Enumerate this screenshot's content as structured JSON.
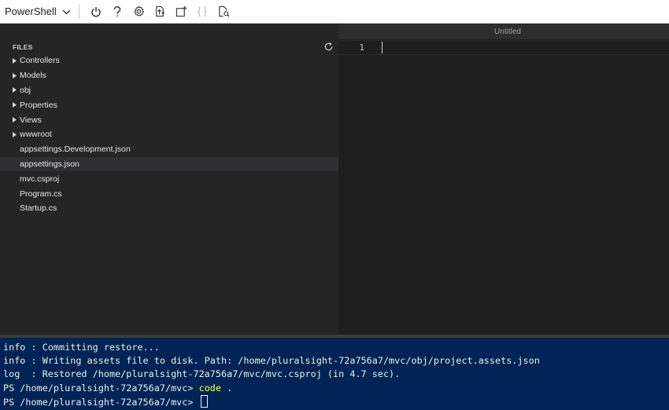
{
  "toolbar": {
    "shell_label": "PowerShell",
    "buttons": [
      {
        "name": "power-icon"
      },
      {
        "name": "help-icon"
      },
      {
        "name": "settings-icon"
      },
      {
        "name": "upload-download-icon"
      },
      {
        "name": "open-new-session-icon"
      },
      {
        "name": "braces-icon"
      },
      {
        "name": "web-preview-icon"
      }
    ]
  },
  "files": {
    "title": "FILES",
    "items": [
      {
        "label": "Controllers",
        "type": "folder"
      },
      {
        "label": "Models",
        "type": "folder"
      },
      {
        "label": "obj",
        "type": "folder"
      },
      {
        "label": "Properties",
        "type": "folder"
      },
      {
        "label": "Views",
        "type": "folder"
      },
      {
        "label": "wwwroot",
        "type": "folder"
      },
      {
        "label": "appsettings.Development.json",
        "type": "file"
      },
      {
        "label": "appsettings.json",
        "type": "file",
        "selected": true
      },
      {
        "label": "mvc.csproj",
        "type": "file"
      },
      {
        "label": "Program.cs",
        "type": "file"
      },
      {
        "label": "Startup.cs",
        "type": "file"
      }
    ]
  },
  "editor": {
    "tab_title": "Untitled",
    "line_number": "1"
  },
  "terminal": {
    "lines": [
      "info : Committing restore...",
      "info : Writing assets file to disk. Path: /home/pluralsight-72a756a7/mvc/obj/project.assets.json",
      "log  : Restored /home/pluralsight-72a756a7/mvc/mvc.csproj (in 4.7 sec)."
    ],
    "prompt": "PS /home/pluralsight-72a756a7/mvc> ",
    "command": "code .",
    "current_prompt": "PS /home/pluralsight-72a756a7/mvc> "
  },
  "colors": {
    "terminal_bg": "#012456",
    "command_color": "#ffff66",
    "editor_bg": "#1e1e1e",
    "sidebar_bg": "#252526"
  }
}
